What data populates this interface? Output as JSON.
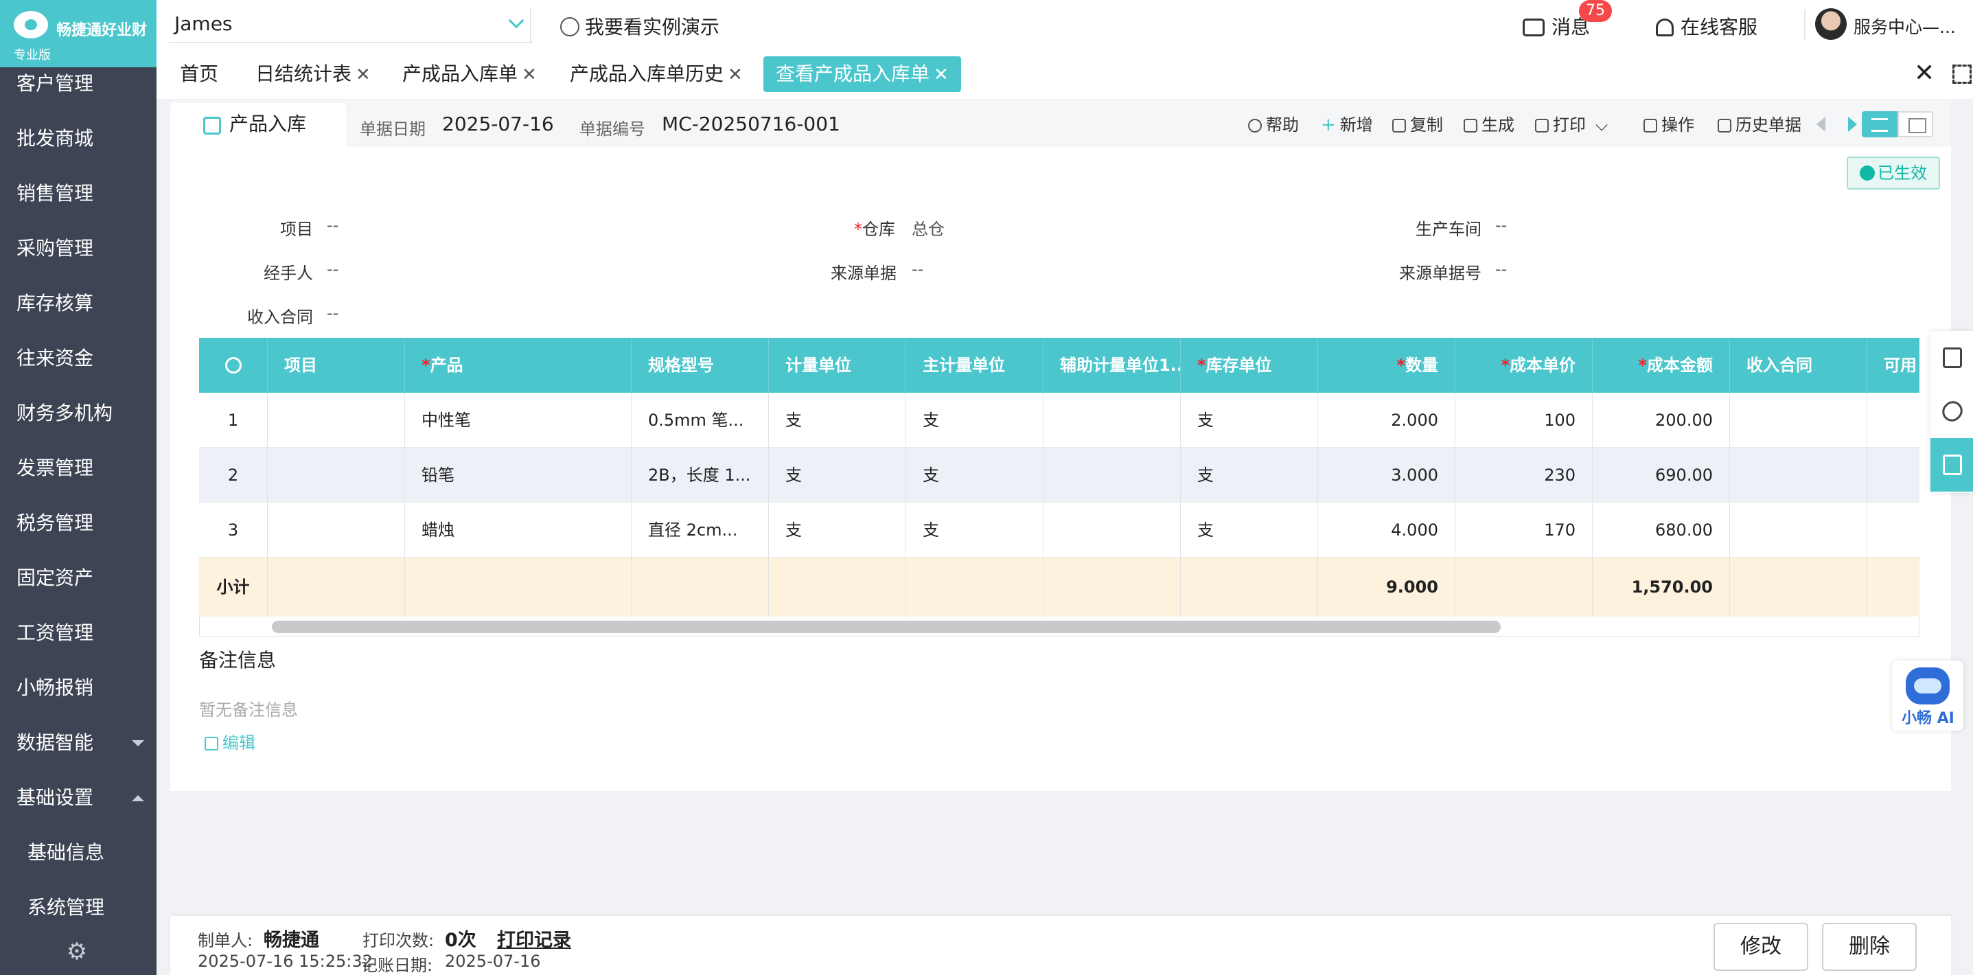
{
  "app": {
    "name": "畅捷通好业财",
    "edition": "专业版",
    "brand_color": "#4ac6cc",
    "sidebar_color": "#3d4453"
  },
  "sidebar": {
    "items": [
      {
        "label": "客户管理"
      },
      {
        "label": "批发商城"
      },
      {
        "label": "销售管理"
      },
      {
        "label": "采购管理"
      },
      {
        "label": "库存核算"
      },
      {
        "label": "往来资金"
      },
      {
        "label": "财务多机构"
      },
      {
        "label": "发票管理"
      },
      {
        "label": "税务管理"
      },
      {
        "label": "固定资产"
      },
      {
        "label": "工资管理"
      },
      {
        "label": "小畅报销"
      },
      {
        "label": "数据智能",
        "arrow": "down"
      },
      {
        "label": "基础设置",
        "arrow": "up"
      },
      {
        "label": "基础信息",
        "sub": true
      },
      {
        "label": "系统管理",
        "sub": true
      }
    ],
    "settings_icon": "gear-icon"
  },
  "topbar": {
    "account": "James",
    "demo_label": "我要看实例演示",
    "messages_label": "消息",
    "messages_badge": "75",
    "support_label": "在线客服",
    "user_label": "服务中心—..."
  },
  "tabs": [
    {
      "label": "首页",
      "closable": false
    },
    {
      "label": "日结统计表",
      "closable": true
    },
    {
      "label": "产成品入库单",
      "closable": true
    },
    {
      "label": "产成品入库单历史",
      "closable": true
    },
    {
      "label": "查看产成品入库单",
      "closable": true,
      "active": true
    }
  ],
  "doc": {
    "tab_label": "产品入库",
    "date_label": "单据日期",
    "date_value": "2025-07-16",
    "number_label": "单据编号",
    "number_value": "MC-20250716-001",
    "toolbar": {
      "help": "帮助",
      "add": "新增",
      "copy": "复制",
      "generate": "生成",
      "print": "打印",
      "operate": "操作",
      "history": "历史单据"
    },
    "status": "已生效",
    "fields": {
      "project_label": "项目",
      "project_value": "--",
      "warehouse_label": "仓库",
      "warehouse_value": "总仓",
      "workshop_label": "生产车间",
      "workshop_value": "--",
      "handler_label": "经手人",
      "handler_value": "--",
      "source_doc_label": "来源单据",
      "source_doc_value": "--",
      "source_no_label": "来源单据号",
      "source_no_value": "--",
      "contract_label": "收入合同",
      "contract_value": "--"
    }
  },
  "grid": {
    "columns": [
      {
        "label": "",
        "required": false
      },
      {
        "label": "项目",
        "required": false
      },
      {
        "label": "产品",
        "required": true
      },
      {
        "label": "规格型号",
        "required": false
      },
      {
        "label": "计量单位",
        "required": false
      },
      {
        "label": "主计量单位",
        "required": false
      },
      {
        "label": "辅助计量单位1...",
        "required": false
      },
      {
        "label": "库存单位",
        "required": true
      },
      {
        "label": "数量",
        "required": true
      },
      {
        "label": "成本单价",
        "required": true
      },
      {
        "label": "成本金额",
        "required": true
      },
      {
        "label": "收入合同",
        "required": false
      },
      {
        "label": "可用",
        "required": false
      }
    ],
    "rows": [
      {
        "no": "1",
        "project": "",
        "product": "中性笔",
        "spec": "0.5mm 笔...",
        "unit": "支",
        "main_unit": "支",
        "aux_unit": "",
        "stock_unit": "支",
        "qty": "2.000",
        "unit_cost": "100",
        "amount": "200.00",
        "contract": ""
      },
      {
        "no": "2",
        "project": "",
        "product": "铅笔",
        "spec": "2B，长度 1...",
        "unit": "支",
        "main_unit": "支",
        "aux_unit": "",
        "stock_unit": "支",
        "qty": "3.000",
        "unit_cost": "230",
        "amount": "690.00",
        "contract": ""
      },
      {
        "no": "3",
        "project": "",
        "product": "蜡烛",
        "spec": "直径 2cm...",
        "unit": "支",
        "main_unit": "支",
        "aux_unit": "",
        "stock_unit": "支",
        "qty": "4.000",
        "unit_cost": "170",
        "amount": "680.00",
        "contract": ""
      }
    ],
    "subtotal": {
      "label": "小计",
      "qty": "9.000",
      "amount": "1,570.00"
    }
  },
  "notes": {
    "title": "备注信息",
    "empty": "暂无备注信息",
    "edit": "编辑"
  },
  "ai": {
    "label": "小畅 AI"
  },
  "footer": {
    "creator_label": "制单人:",
    "creator_value": "畅捷通",
    "print_count_label": "打印次数:",
    "print_count_value": "0次",
    "print_record": "打印记录",
    "created_time": "2025-07-16 15:25:32",
    "posting_date_label": "记账日期:",
    "posting_date_value": "2025-07-16",
    "edit_button": "修改",
    "delete_button": "删除"
  }
}
